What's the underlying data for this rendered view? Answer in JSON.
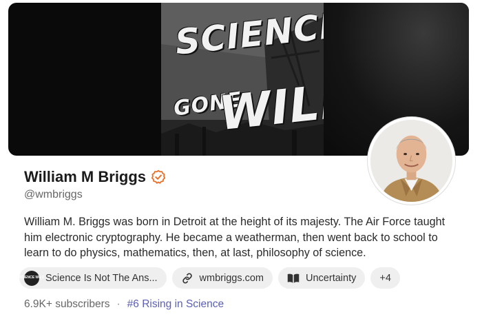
{
  "banner": {
    "title_line1": "SCIENCE",
    "title_line2": "GONE",
    "title_line3": "WILD!"
  },
  "profile": {
    "name": "William M Briggs",
    "handle": "@wmbriggs",
    "bio": "William M. Briggs was born in Detroit at the height of its majesty. The Air Force taught him electronic cryptography. He became a weatherman, then went back to school to learn to do physics, mathematics, then, at last, philosophy of science.",
    "verified_icon": "verified-check-icon",
    "accent_color": "#e8702a"
  },
  "chips": {
    "publication": {
      "label": "Science Is Not The Ans...",
      "logo_text": "SCIENCE WILD",
      "icon": "publication-logo"
    },
    "website": {
      "label": "wmbriggs.com",
      "icon": "link-icon"
    },
    "book": {
      "label": "Uncertainty",
      "icon": "book-icon"
    },
    "more": {
      "label": "+4"
    }
  },
  "stats": {
    "subscribers": "6.9K+ subscribers",
    "separator": "·",
    "rank": "#6 Rising in Science",
    "rank_color": "#5b5fb5"
  }
}
